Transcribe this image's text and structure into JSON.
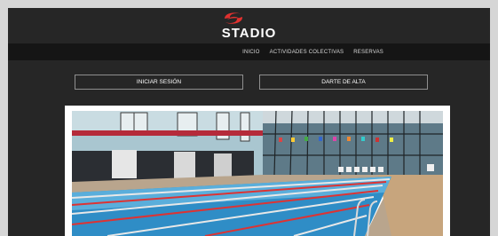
{
  "brand": {
    "name": "STADIO"
  },
  "nav": {
    "items": [
      "INICIO",
      "ACTIVIDADES COLECTIVAS",
      "RESERVAS"
    ]
  },
  "actions": {
    "login_label": "INICIAR SESIÓN",
    "signup_label": "DARTE DE ALTA"
  },
  "hero": {
    "alt": "pool-photo"
  },
  "colors": {
    "accent": "#e0312f",
    "background": "#262626",
    "nav_bar": "#151515"
  }
}
